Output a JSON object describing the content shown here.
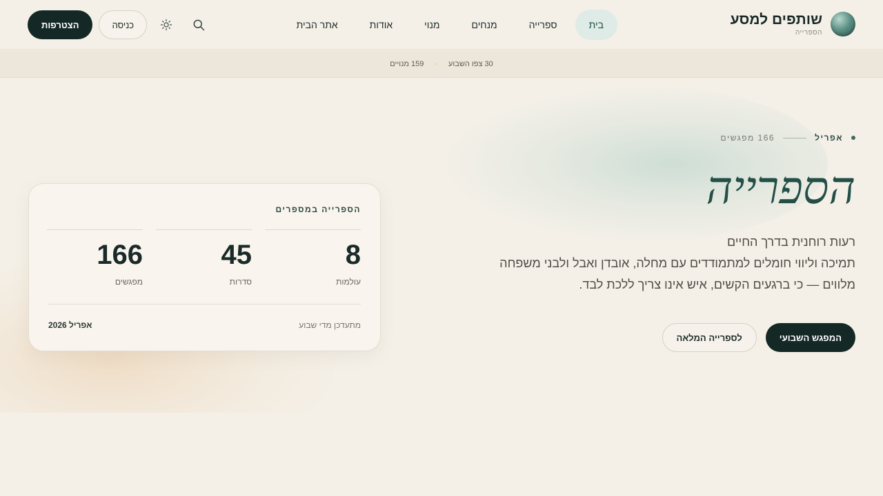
{
  "brand": {
    "title": "שותפים למסע",
    "subtitle": "הספרייה"
  },
  "nav": {
    "items": [
      {
        "label": "בית",
        "active": true
      },
      {
        "label": "ספרייה",
        "active": false
      },
      {
        "label": "מנחים",
        "active": false
      },
      {
        "label": "מנוי",
        "active": false
      },
      {
        "label": "אודות",
        "active": false
      },
      {
        "label": "אתר הבית",
        "active": false
      }
    ]
  },
  "header_actions": {
    "join_label": "הצטרפות",
    "login_label": "כניסה",
    "theme_icon": "sun-icon",
    "search_icon": "search-icon"
  },
  "strip": {
    "watched_week": "30 צפו השבוע",
    "subscribers": "159 מנויים"
  },
  "hero": {
    "eyebrow_month": "אפריל",
    "eyebrow_count": "166 מפגשים",
    "title": "הספרייה",
    "description_lines": [
      "רעות רוחנית בדרך החיים",
      "תמיכה וליווי חומלים למתמודדים עם מחלה, אובדן ואבל ולבני משפחה",
      "מלווים — כי ברגעים הקשים, איש אינו צריך ללכת לבד."
    ],
    "primary_button": "המפגש השבועי",
    "secondary_button": "לספרייה המלאה"
  },
  "stats_card": {
    "title": "הספרייה במספרים",
    "stats": [
      {
        "value": "8",
        "label": "עולמות"
      },
      {
        "value": "45",
        "label": "סדרות"
      },
      {
        "value": "166",
        "label": "מפגשים"
      }
    ],
    "footer_note": "מתעדכן מדי שבוע",
    "footer_date": "אפריל 2026"
  },
  "colors": {
    "background": "#f4f0e8",
    "accent_dark": "#142826",
    "accent_green": "#234f47",
    "nav_active_bg": "#deebe6"
  }
}
